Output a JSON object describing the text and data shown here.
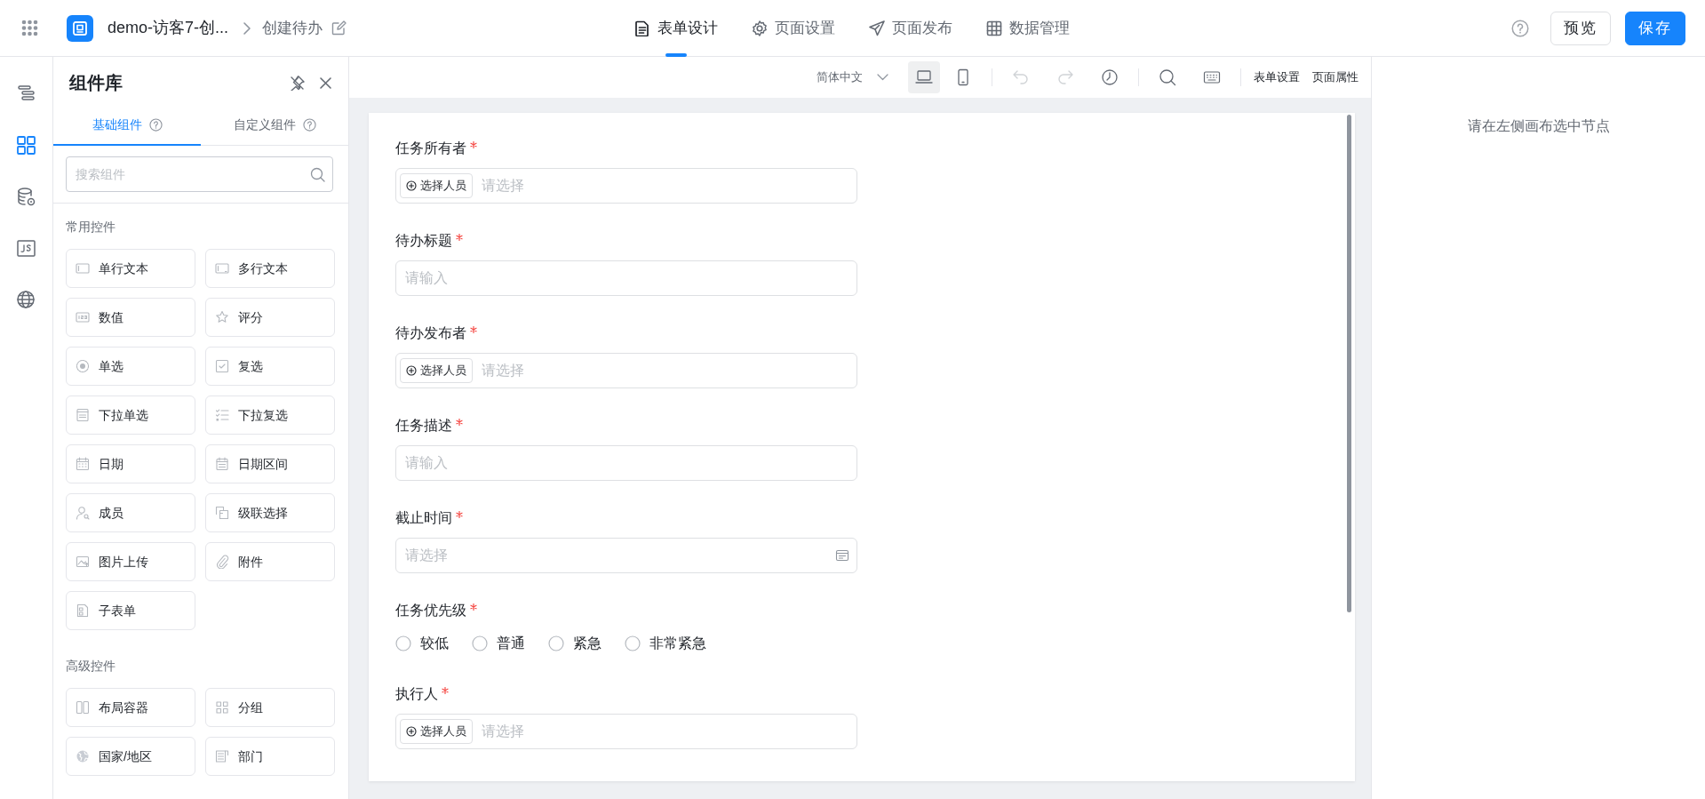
{
  "app_bar": {
    "app_name": "demo-访客7-创...",
    "page_name": "创建待办",
    "tabs": [
      {
        "label": "表单设计",
        "selected": true
      },
      {
        "label": "页面设置",
        "selected": false
      },
      {
        "label": "页面发布",
        "selected": false
      },
      {
        "label": "数据管理",
        "selected": false
      }
    ],
    "buttons": [
      {
        "label": "预览",
        "kind": "default"
      },
      {
        "label": "保存",
        "kind": "primary"
      }
    ]
  },
  "rail": [
    {
      "selected": false
    },
    {
      "selected": true
    },
    {
      "selected": false
    },
    {
      "selected": false
    },
    {
      "selected": false
    }
  ],
  "component_panel": {
    "title": "组件库",
    "tabs": [
      {
        "label": "基础组件",
        "selected": true
      },
      {
        "label": "自定义组件",
        "selected": false
      }
    ],
    "search": {
      "placeholder": "搜索组件"
    },
    "sections": [
      {
        "title": "常用控件",
        "items": [
          "单行文本",
          "多行文本",
          "数值",
          "评分",
          "单选",
          "复选",
          "下拉单选",
          "下拉复选",
          "日期",
          "日期区间",
          "成员",
          "级联选择",
          "图片上传",
          "附件",
          "子表单"
        ]
      },
      {
        "title": "高级控件",
        "items": [
          "布局容器",
          "分组",
          "国家/地区",
          "部门"
        ]
      }
    ]
  },
  "toolbar": {
    "language": "简体中文",
    "devices": [
      {
        "selected": true
      },
      {
        "selected": false
      }
    ],
    "history": [
      {
        "disabled": true
      },
      {
        "disabled": true
      }
    ],
    "links": [
      "表单设置",
      "页面属性"
    ]
  },
  "form": {
    "fields": [
      {
        "kind": "member",
        "label": "任务所有者",
        "required": true,
        "button": "选择人员",
        "placeholder": "请选择"
      },
      {
        "kind": "input",
        "label": "待办标题",
        "required": true,
        "placeholder": "请输入"
      },
      {
        "kind": "member",
        "label": "待办发布者",
        "required": true,
        "button": "选择人员",
        "placeholder": "请选择"
      },
      {
        "kind": "input",
        "label": "任务描述",
        "required": true,
        "placeholder": "请输入"
      },
      {
        "kind": "date",
        "label": "截止时间",
        "required": true,
        "placeholder": "请选择"
      },
      {
        "kind": "radio",
        "label": "任务优先级",
        "required": true,
        "options": [
          {
            "label": "较低",
            "selected": false
          },
          {
            "label": "普通",
            "selected": false
          },
          {
            "label": "紧急",
            "selected": false
          },
          {
            "label": "非常紧急",
            "selected": false
          }
        ]
      },
      {
        "kind": "member",
        "label": "执行人",
        "required": true,
        "button": "选择人员",
        "placeholder": "请选择"
      }
    ]
  },
  "inspector": {
    "hint": "请在左侧画布选中节点"
  }
}
